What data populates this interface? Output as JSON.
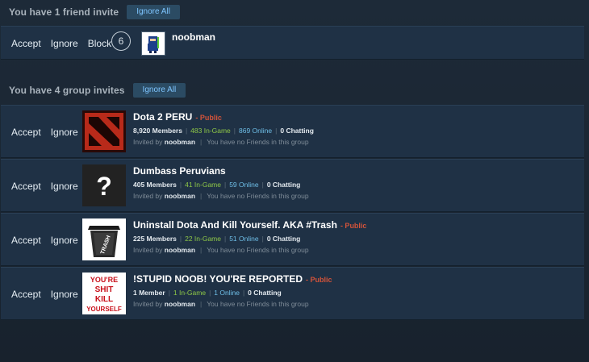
{
  "friend_section": {
    "title": "You have 1 friend invite",
    "ignore_all": "Ignore All",
    "invite": {
      "accept": "Accept",
      "ignore": "Ignore",
      "block": "Block",
      "level": "6",
      "name": "noobman"
    }
  },
  "group_section": {
    "title": "You have 4 group invites",
    "ignore_all": "Ignore All",
    "groups": [
      {
        "accept": "Accept",
        "ignore": "Ignore",
        "name": "Dota 2 PERU",
        "public": "- Public",
        "members": "8,920 Members",
        "in_game": "483 In-Game",
        "online": "869 Online",
        "chatting": "0 Chatting",
        "invited_by_label": "Invited by",
        "invited_by": "noobman",
        "friends_note": "You have no Friends in this group"
      },
      {
        "accept": "Accept",
        "ignore": "Ignore",
        "name": "Dumbass Peruvians",
        "public": "",
        "members": "405 Members",
        "in_game": "41 In-Game",
        "online": "59 Online",
        "chatting": "0 Chatting",
        "invited_by_label": "Invited by",
        "invited_by": "noobman",
        "friends_note": "You have no Friends in this group"
      },
      {
        "accept": "Accept",
        "ignore": "Ignore",
        "name": "Uninstall Dota And Kill Yourself. AKA #Trash",
        "public": "- Public",
        "members": "225 Members",
        "in_game": "22 In-Game",
        "online": "51 Online",
        "chatting": "0 Chatting",
        "invited_by_label": "Invited by",
        "invited_by": "noobman",
        "friends_note": "You have no Friends in this group"
      },
      {
        "accept": "Accept",
        "ignore": "Ignore",
        "name": "!STUPID NOOB! YOU'RE REPORTED",
        "public": "- Public",
        "members": "1 Member",
        "in_game": "1 In-Game",
        "online": "1 Online",
        "chatting": "0 Chatting",
        "invited_by_label": "Invited by",
        "invited_by": "noobman",
        "friends_note": "You have no Friends in this group",
        "icon_text": [
          "YOU'RE",
          "SHIT",
          "KILL",
          "YOURSELF"
        ]
      }
    ]
  }
}
